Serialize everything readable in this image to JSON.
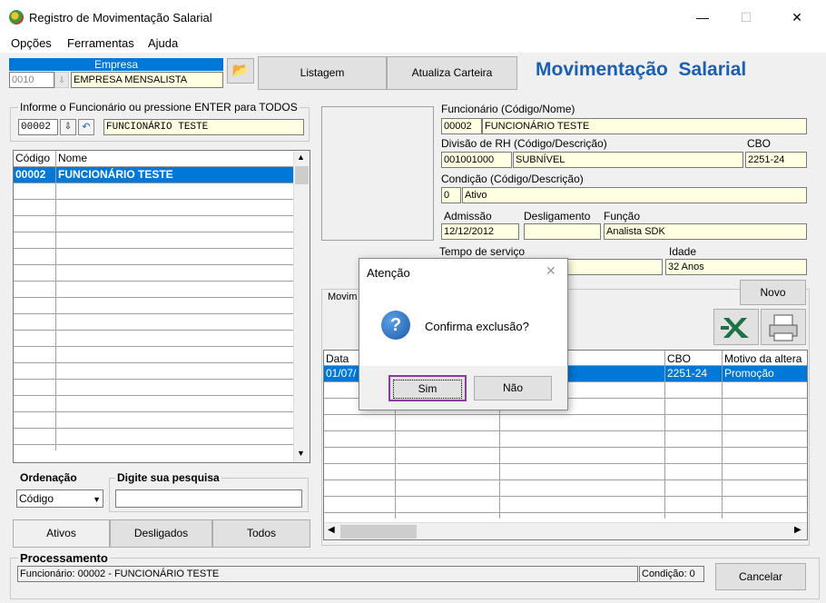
{
  "window": {
    "title": "Registro de Movimentação Salarial",
    "controls": {
      "minimize": "—",
      "maximize": "☐",
      "close": "✕"
    }
  },
  "menu": [
    {
      "label": "Opções"
    },
    {
      "label": "Ferramentas"
    },
    {
      "label": "Ajuda"
    }
  ],
  "empresa": {
    "header": "Empresa",
    "code": "0010",
    "name": "EMPRESA MENSALISTA"
  },
  "toolbar": {
    "listagem": "Listagem",
    "atualiza": "Atualiza Carteira",
    "heading": "Movimentação  Salarial"
  },
  "employee_search": {
    "legend": "Informe o Funcionário ou pressione ENTER para TODOS",
    "code": "00002",
    "name": "FUNCIONÁRIO TESTE"
  },
  "employee_list": {
    "columns": [
      "Código",
      "Nome"
    ],
    "rows": [
      {
        "code": "00002",
        "name": "FUNCIONÁRIO TESTE"
      }
    ]
  },
  "ordenacao": {
    "label": "Ordenação",
    "value": "Código"
  },
  "pesquisa": {
    "label": "Digite sua pesquisa",
    "value": ""
  },
  "filter_buttons": {
    "ativos": "Ativos",
    "desligados": "Desligados",
    "todos": "Todos"
  },
  "details": {
    "funcionario_label": "Funcionário (Código/Nome)",
    "funcionario_code": "00002",
    "funcionario_name": "FUNCIONÁRIO TESTE",
    "divisao_label": "Divisão de RH (Código/Descrição)",
    "divisao_code": "001001000",
    "divisao_desc": "SUBNÍVEL",
    "cbo_label": "CBO",
    "cbo_value": "2251-24",
    "condicao_label": "Condição (Código/Descrição)",
    "condicao_code": "0",
    "condicao_desc": "Ativo",
    "admissao_label": "Admissão",
    "admissao_value": "12/12/2012",
    "desligamento_label": "Desligamento",
    "desligamento_value": "",
    "funcao_label": "Função",
    "funcao_value": "Analista SDK",
    "tempo_label": "Tempo de serviço",
    "tempo_value": "",
    "idade_label": "Idade",
    "idade_value": "32 Anos"
  },
  "movimentacao": {
    "tab_label": "Movim",
    "novo_button": "Novo",
    "columns": [
      "Data",
      "",
      "",
      "CBO",
      "Motivo da altera"
    ],
    "rows": [
      {
        "data": "01/07/",
        "cbo": "2251-24",
        "motivo": "Promoção"
      }
    ]
  },
  "processamento": {
    "label": "Processamento",
    "status": "Funcionário: 00002 - FUNCIONÁRIO TESTE",
    "condicao": "Condição: 0",
    "cancelar": "Cancelar"
  },
  "dialog": {
    "title": "Atenção",
    "message": "Confirma exclusão?",
    "yes": "Sim",
    "no": "Não"
  },
  "colors": {
    "heading_blue": "#1a5fb4",
    "selection": "#0078d7",
    "field_yellow": "#ffffe1",
    "dialog_focus_border": "#8b3c9e"
  }
}
